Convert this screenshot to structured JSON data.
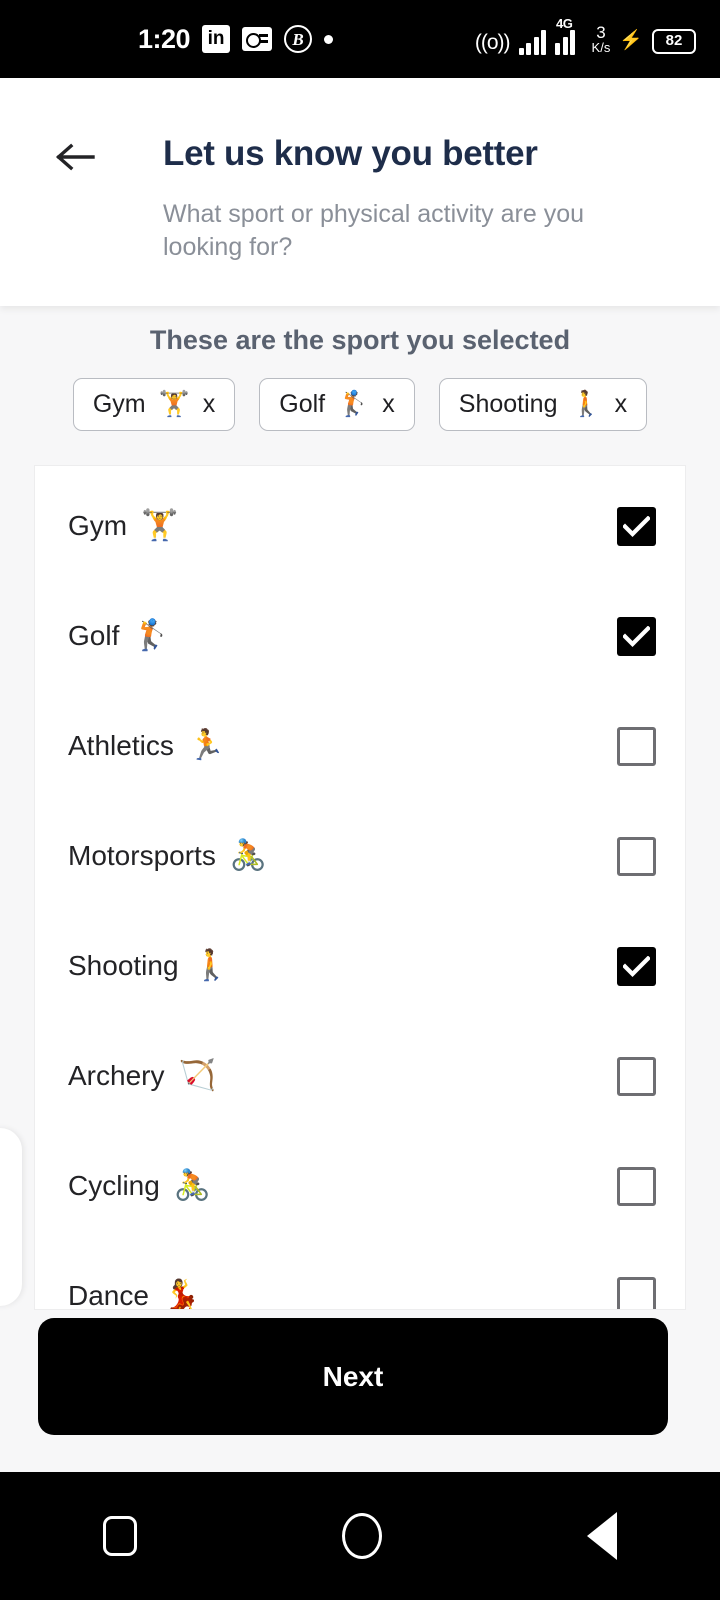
{
  "statusbar": {
    "time": "1:20",
    "icons_left": [
      "linkedin-icon",
      "radio-icon",
      "beta-badge-icon",
      "dot-icon"
    ],
    "linkedin_label": "in",
    "beta_label": "B",
    "cast_icon": "((o))",
    "network_type": "4G",
    "net_speed_value": "3",
    "net_speed_unit": "K/s",
    "charging_icon": "⚡",
    "battery_level": "82"
  },
  "header": {
    "back_icon": "arrow-left-icon",
    "title": "Let us know you better",
    "subtitle": "What sport or physical activity are you looking for?"
  },
  "selected": {
    "heading": "These are the sport you selected",
    "remove_label": "x",
    "chips": [
      {
        "label": "Gym",
        "emoji": "🏋️"
      },
      {
        "label": "Golf",
        "emoji": "🏌️"
      },
      {
        "label": "Shooting",
        "emoji": "🚶"
      }
    ]
  },
  "sports_list": [
    {
      "label": "Gym",
      "emoji": "🏋️",
      "checked": true
    },
    {
      "label": "Golf",
      "emoji": "🏌️",
      "checked": true
    },
    {
      "label": "Athletics",
      "emoji": "🏃",
      "checked": false
    },
    {
      "label": "Motorsports",
      "emoji": "🚴",
      "checked": false
    },
    {
      "label": "Shooting",
      "emoji": "🚶",
      "checked": true
    },
    {
      "label": "Archery",
      "emoji": "🏹",
      "checked": false
    },
    {
      "label": "Cycling",
      "emoji": "🚴",
      "checked": false
    },
    {
      "label": "Dance",
      "emoji": "💃",
      "checked": false
    }
  ],
  "footer": {
    "next_label": "Next"
  },
  "navbar": {
    "recents": "recents-icon",
    "home": "home-icon",
    "back": "back-icon"
  },
  "colors": {
    "title": "#1e2d4a",
    "subtitle": "#8a8f98",
    "heading": "#5a6270",
    "accent": "#000000",
    "page_bg": "#f7f7f8"
  }
}
